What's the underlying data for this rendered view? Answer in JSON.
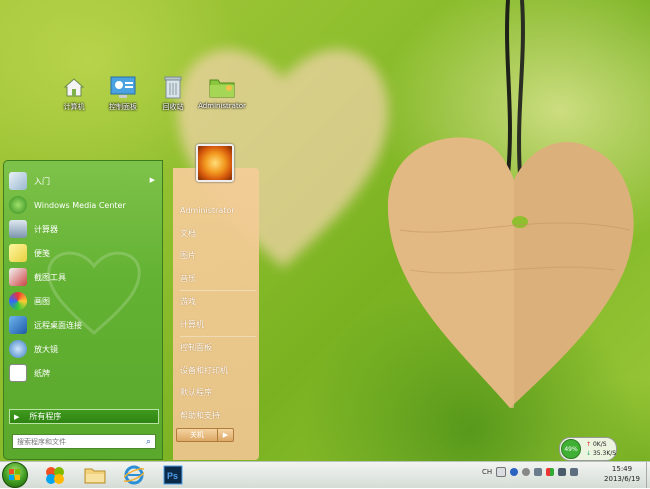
{
  "desktop": {
    "icons": [
      {
        "label": "计算机",
        "icon": "computer-icon"
      },
      {
        "label": "控制面板",
        "icon": "control-panel-icon"
      },
      {
        "label": "回收站",
        "icon": "recycle-bin-icon"
      },
      {
        "label": "Administrator",
        "icon": "user-folder-icon"
      }
    ]
  },
  "start_menu": {
    "programs": [
      {
        "label": "入门",
        "icon": "getting-started-icon",
        "has_submenu": true
      },
      {
        "label": "Windows Media Center",
        "icon": "media-center-icon"
      },
      {
        "label": "计算器",
        "icon": "calculator-icon"
      },
      {
        "label": "便笺",
        "icon": "sticky-notes-icon"
      },
      {
        "label": "截图工具",
        "icon": "snipping-tool-icon"
      },
      {
        "label": "画图",
        "icon": "paint-icon"
      },
      {
        "label": "远程桌面连接",
        "icon": "remote-desktop-icon"
      },
      {
        "label": "放大镜",
        "icon": "magnifier-icon"
      },
      {
        "label": "纸牌",
        "icon": "solitaire-icon"
      }
    ],
    "all_programs": "所有程序",
    "search_placeholder": "搜索程序和文件",
    "right_items": [
      {
        "label": "Administrator"
      },
      {
        "label": "文档"
      },
      {
        "label": "图片"
      },
      {
        "label": "音乐"
      },
      {
        "label": "游戏"
      },
      {
        "label": "计算机"
      },
      {
        "label": "控制面板"
      },
      {
        "label": "设备和打印机"
      },
      {
        "label": "默认程序"
      },
      {
        "label": "帮助和支持"
      }
    ],
    "shutdown": "关机"
  },
  "net_widget": {
    "percent": "49%",
    "up": "0K/S",
    "down": "35.3K/S"
  },
  "taskbar": {
    "pinned": [
      "windows-media-player-icon",
      "file-explorer-icon",
      "internet-explorer-icon",
      "photoshop-icon"
    ],
    "tray_lang": "CH",
    "clock_time": "15:49",
    "clock_date": "2013/6/19"
  }
}
